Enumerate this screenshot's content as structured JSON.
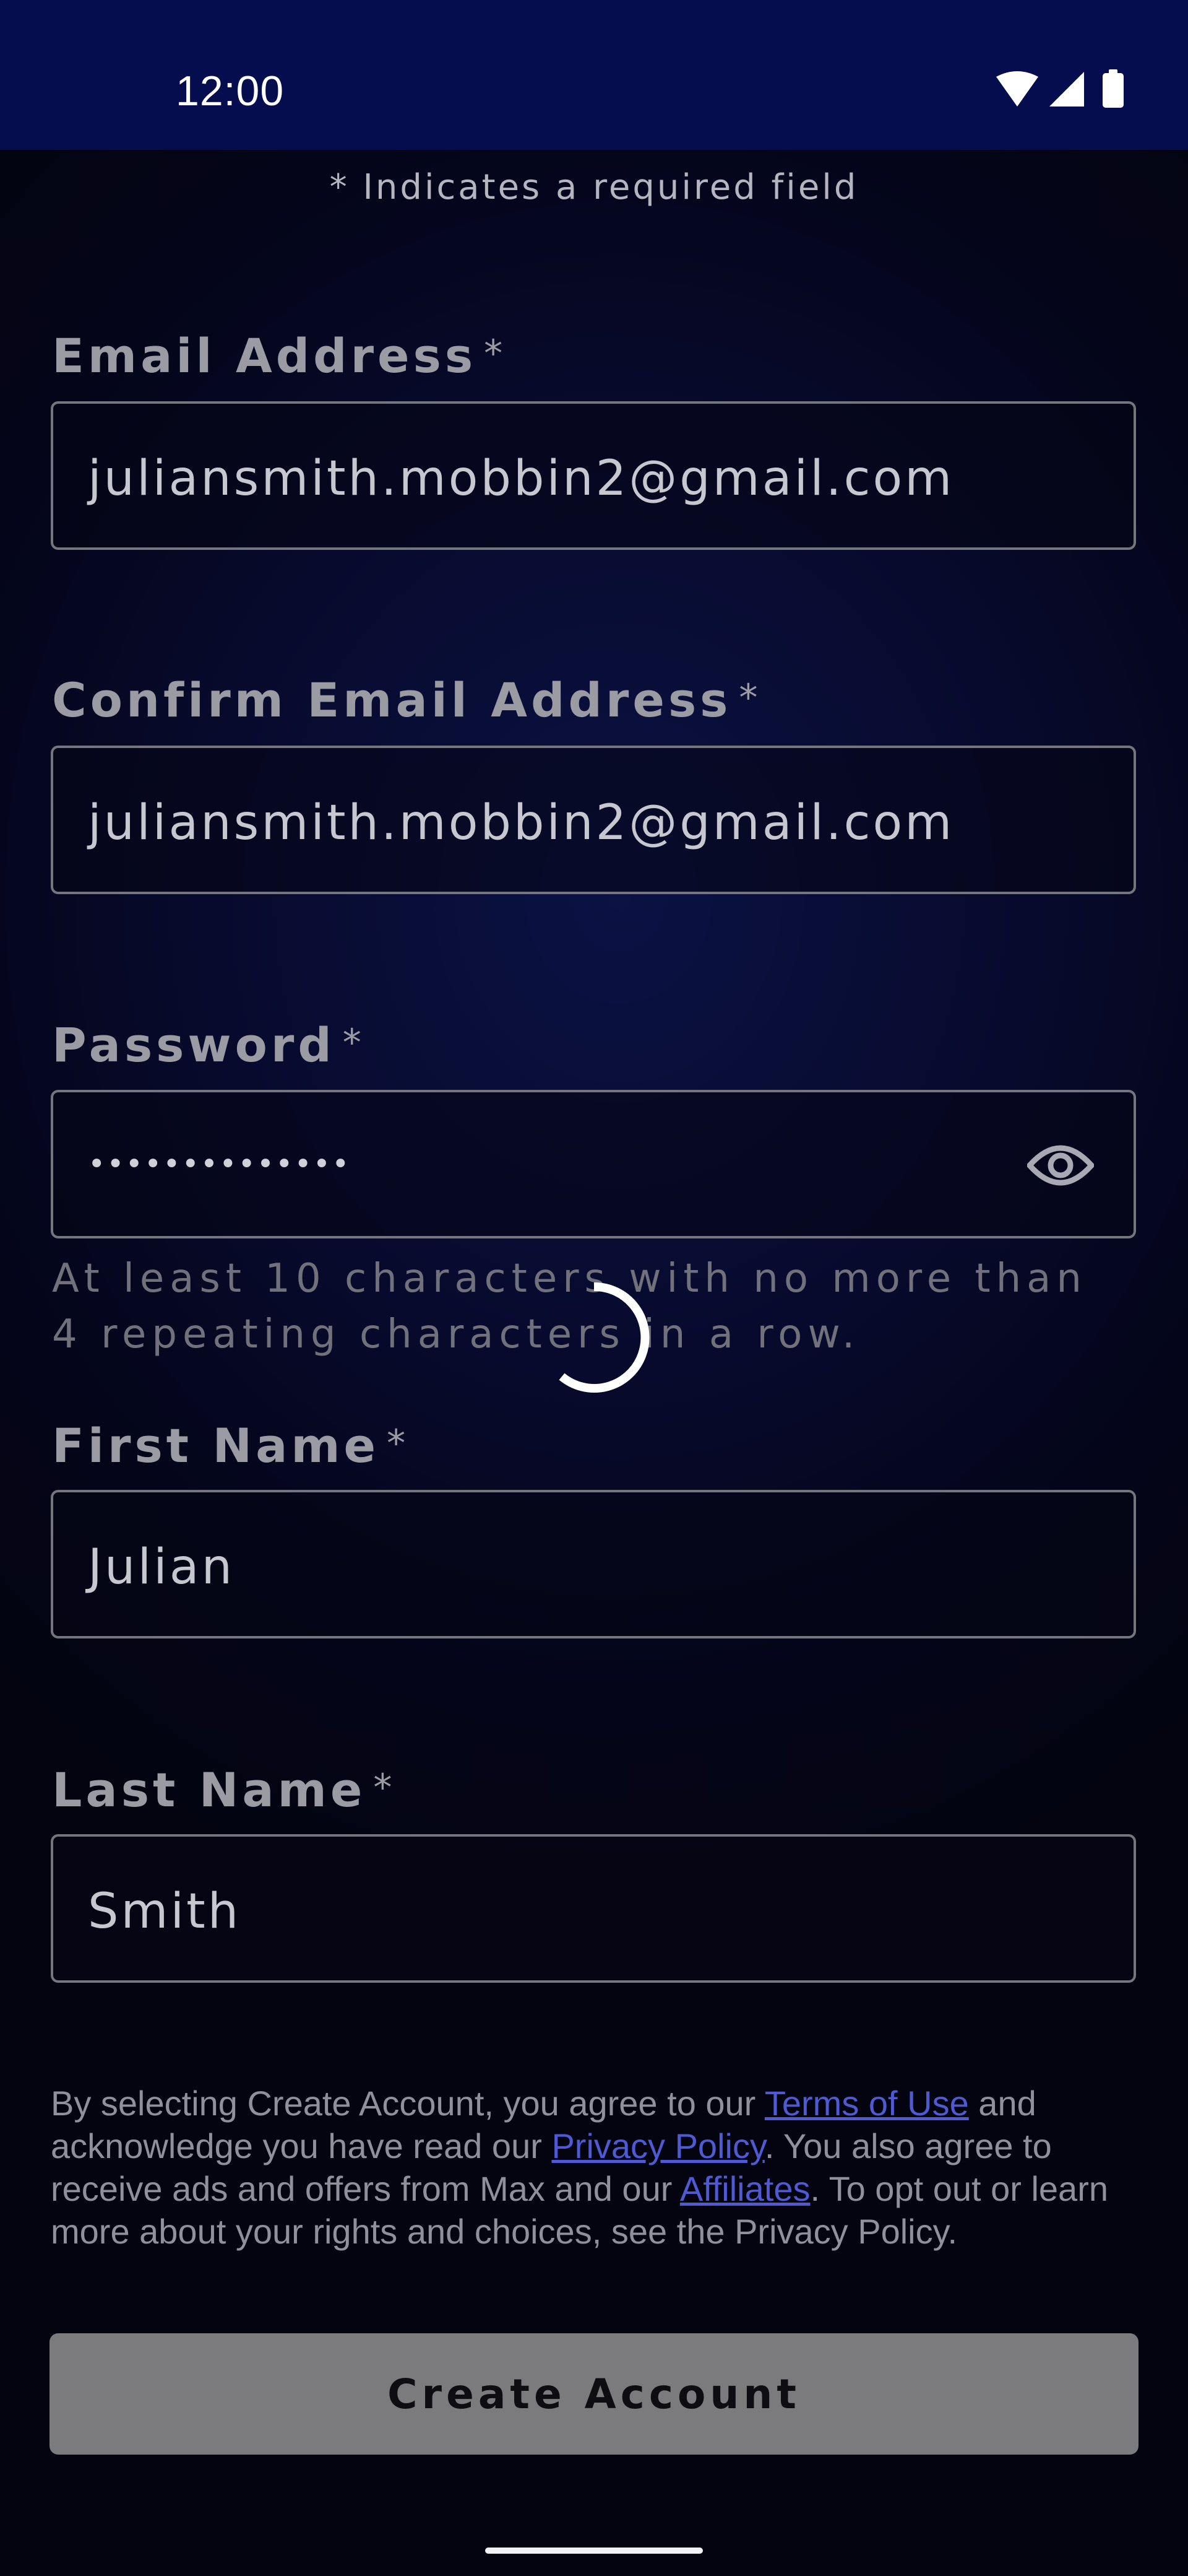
{
  "status_bar": {
    "time": "12:00",
    "icons": [
      "wifi-icon",
      "signal-icon",
      "battery-icon"
    ]
  },
  "form": {
    "required_note": "* Indicates a required field",
    "required_marker": "*",
    "email": {
      "label": "Email Address",
      "value": "juliansmith.mobbin2@gmail.com"
    },
    "confirm_email": {
      "label": "Confirm Email Address",
      "value": "juliansmith.mobbin2@gmail.com"
    },
    "password": {
      "label": "Password",
      "value": "••••••••••••••",
      "hint": "At least 10 characters with no more than 4 repeating characters in a row."
    },
    "first_name": {
      "label": "First Name",
      "value": "Julian"
    },
    "last_name": {
      "label": "Last Name",
      "value": "Smith"
    }
  },
  "legal": {
    "text_1": "By selecting Create Account, you agree to our ",
    "terms_link": "Terms of Use",
    "text_2": " and acknowledge you have read our ",
    "privacy_link": "Privacy Policy",
    "text_3": ". You also agree to receive ads and offers from Max and our ",
    "affiliates_link": "Affiliates",
    "text_4": ". To opt out or learn more about your rights and choices, see the Privacy Policy."
  },
  "create_account_label": "Create Account",
  "colors": {
    "status_bar": "#050d4f",
    "link": "#4d5ad3",
    "button": "#7b7b7e"
  }
}
